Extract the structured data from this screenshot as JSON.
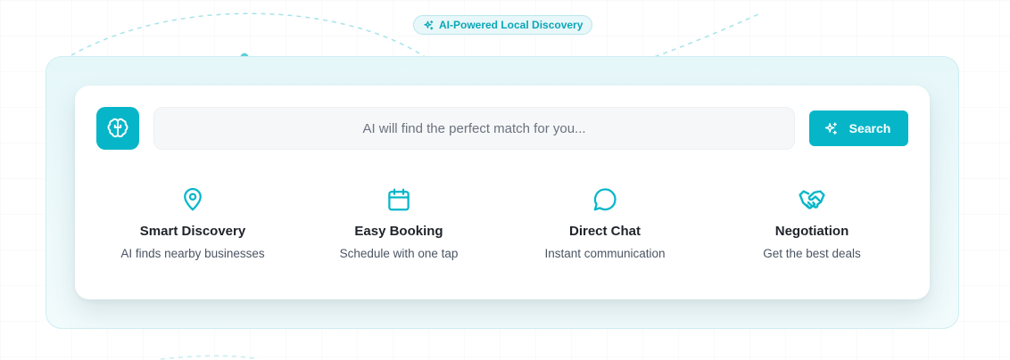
{
  "badge": {
    "label": "AI-Powered Local Discovery",
    "icon": "sparkles-icon"
  },
  "search": {
    "placeholder": "AI will find the perfect match for you...",
    "button_label": "Search",
    "brain_icon": "brain-icon"
  },
  "features": [
    {
      "icon": "map-pin-icon",
      "title": "Smart Discovery",
      "desc": "AI finds nearby businesses"
    },
    {
      "icon": "calendar-icon",
      "title": "Easy Booking",
      "desc": "Schedule with one tap"
    },
    {
      "icon": "chat-bubble-icon",
      "title": "Direct Chat",
      "desc": "Instant communication"
    },
    {
      "icon": "handshake-icon",
      "title": "Negotiation",
      "desc": "Get the best deals"
    }
  ],
  "colors": {
    "accent": "#06b6c8",
    "accent_text": "#0aa7b8"
  }
}
